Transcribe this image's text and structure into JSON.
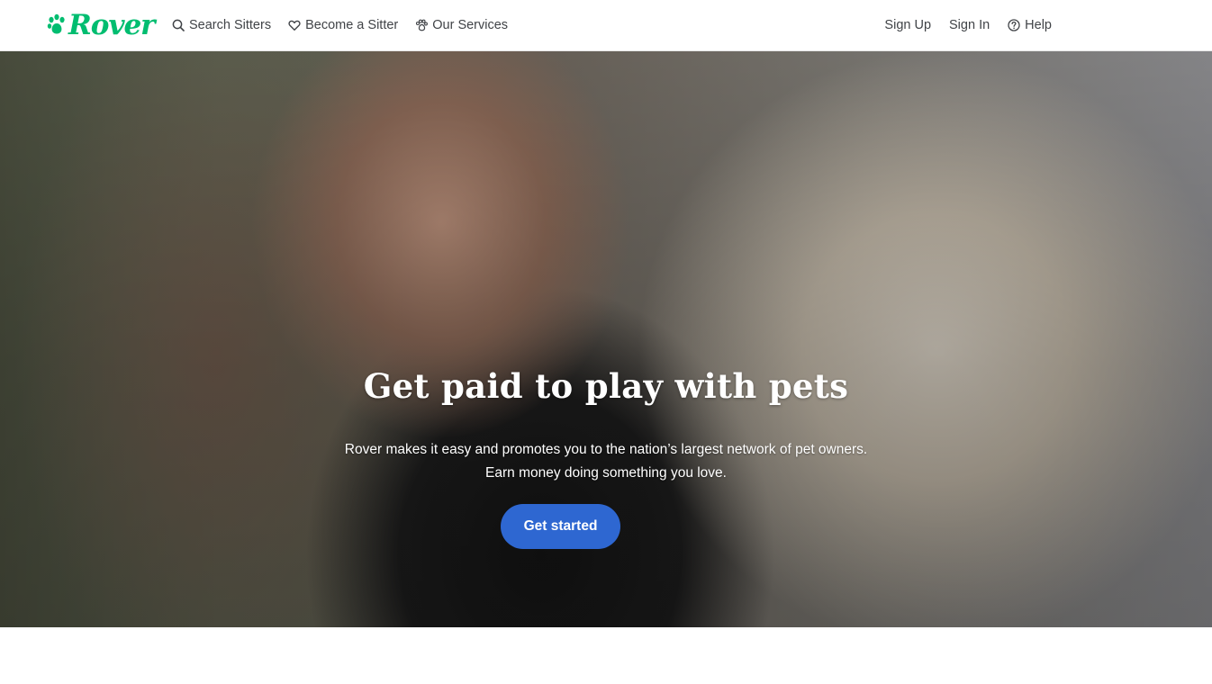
{
  "header": {
    "logo_text": "Rover",
    "nav_left": [
      {
        "label": "Search Sitters",
        "icon": "search-icon"
      },
      {
        "label": "Become a Sitter",
        "icon": "heart-icon"
      },
      {
        "label": "Our Services",
        "icon": "paw-icon"
      }
    ],
    "nav_right": [
      {
        "label": "Sign Up"
      },
      {
        "label": "Sign In"
      },
      {
        "label": "Help",
        "icon": "help-icon"
      }
    ]
  },
  "hero": {
    "title": "Get paid to play with pets",
    "subtitle_line1": "Rover makes it easy and promotes you to the nation’s largest network of pet owners.",
    "subtitle_line2": "Earn money doing something you love.",
    "cta_label": "Get started",
    "image": "woman-with-golden-retriever-photo"
  },
  "colors": {
    "brand": "#00bd70",
    "cta": "#2e67d1",
    "nav_text": "#404347"
  }
}
